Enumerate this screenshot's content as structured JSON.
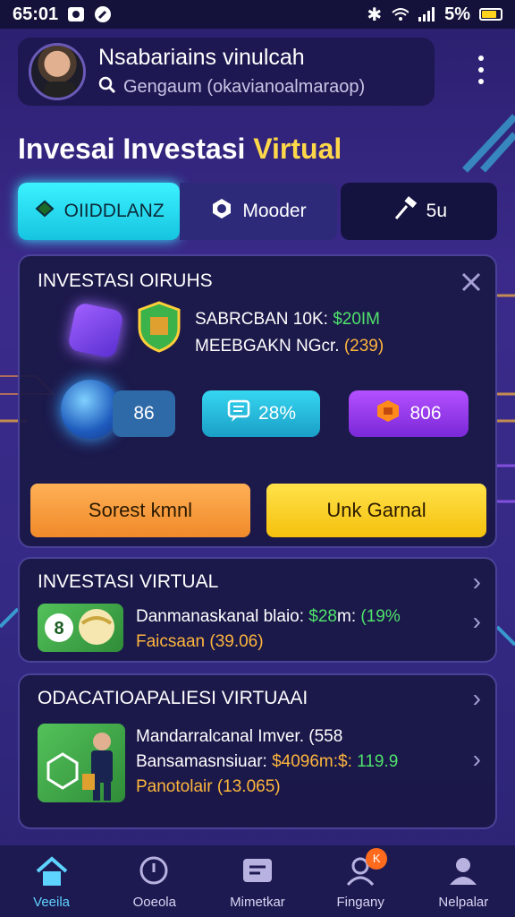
{
  "status_bar": {
    "time": "65:01",
    "battery": "5%",
    "battery_prefix": "5"
  },
  "header": {
    "user_name": "Nsabariains vinulcah",
    "search_placeholder": "Gengaum (okavianoalmaraop)"
  },
  "page_title": {
    "main": "Invesai Investasi",
    "accent": "Virtual"
  },
  "tabs": [
    {
      "label": "OIIDDLANZ",
      "icon": "cube-icon"
    },
    {
      "label": "Mooder",
      "icon": "hex-logo-icon"
    },
    {
      "label": "5u",
      "icon": "hammer-icon"
    }
  ],
  "invest_panel": {
    "title": "INVESTASI OIRUHS",
    "stat_1_label": "SABRCBAN 10K:",
    "stat_1_value": "$20IM",
    "stat_2_label": "MEEBGAKN NGcr.",
    "stat_2_value": "(239)",
    "chips": [
      "86",
      "28%",
      "806"
    ],
    "button_left": "Sorest kmnl",
    "button_right": "Unk Garnal"
  },
  "card_1": {
    "title": "INVESTASI VIRTUAL",
    "line_1_label": "Danmanaskanal blaio:",
    "line_1_value": "$28",
    "line_1_mid": "m:",
    "line_1_pct": "(19%",
    "line_2": "Faicsaan (39.06)",
    "badge": "8"
  },
  "card_2": {
    "title": "ODACATIOAPALIESI VIRTUAAI",
    "line_1": "Mandarralcanal Imver. (558",
    "line_2_label": "Bansamasnsiuar:",
    "line_2_value": "$4096",
    "line_2_mid": "m:$:",
    "line_2_pct": "119.9",
    "line_3": "Panotolair (13.065)"
  },
  "bottom_nav": [
    {
      "label": "Veeila",
      "icon": "home-icon",
      "active": true
    },
    {
      "label": "Ooeola",
      "icon": "search-icon",
      "active": false
    },
    {
      "label": "Mimetkar",
      "icon": "chat-icon",
      "active": false
    },
    {
      "label": "Fingany",
      "icon": "profile-icon",
      "active": false,
      "badge": "K"
    },
    {
      "label": "Nelpalar",
      "icon": "user-icon",
      "active": false
    }
  ],
  "colors": {
    "accent_cyan": "#3cf2ff",
    "accent_yellow": "#ffd84a",
    "green": "#4fe36b",
    "orange": "#ffb63c"
  }
}
